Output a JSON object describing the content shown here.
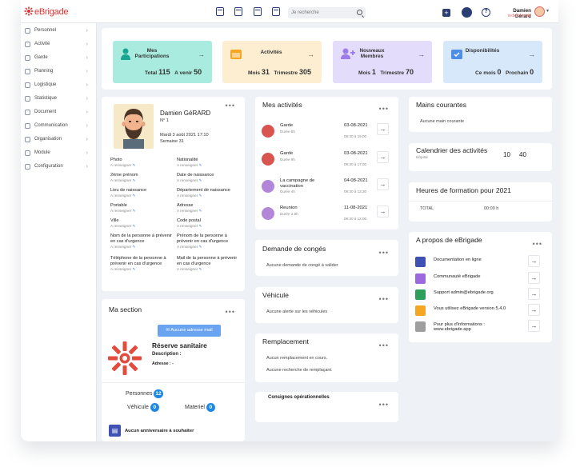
{
  "brand": {
    "name": "eBrigade",
    "color": "#d33"
  },
  "topbar": {
    "search_placeholder": "Je recherche",
    "user_name": "Damien Gérard",
    "user_status": "indisponible"
  },
  "sidebar": {
    "items": [
      {
        "label": "Personnel",
        "icon": "user-icon"
      },
      {
        "label": "Activité",
        "icon": "activity-icon"
      },
      {
        "label": "Garde",
        "icon": "shield-icon"
      },
      {
        "label": "Planning",
        "icon": "calendar-icon"
      },
      {
        "label": "Logistique",
        "icon": "truck-icon"
      },
      {
        "label": "Statistique",
        "icon": "chart-icon"
      },
      {
        "label": "Document",
        "icon": "document-icon"
      },
      {
        "label": "Communication",
        "icon": "mail-icon"
      },
      {
        "label": "Organisation",
        "icon": "org-icon"
      },
      {
        "label": "Module",
        "icon": "module-icon"
      },
      {
        "label": "Configuration",
        "icon": "gear-icon"
      }
    ]
  },
  "stats": [
    {
      "title": "Mes Participations",
      "v1_label": "Total",
      "v1": "115",
      "v2_label": "A venir",
      "v2": "50",
      "bg": "#a9ecdf",
      "color": "#1aa592"
    },
    {
      "title": "Activités",
      "v1_label": "Mois",
      "v1": "31",
      "v2_label": "Trimestre",
      "v2": "305",
      "bg": "#fdeed2",
      "color": "#f5a623"
    },
    {
      "title": "Nouveaux Membres",
      "v1_label": "Mois",
      "v1": "1",
      "v2_label": "Trimestre",
      "v2": "70",
      "bg": "#e4dcfb",
      "color": "#9a7be8"
    },
    {
      "title": "Disponibilités",
      "v1_label": "Ce mois",
      "v1": "0",
      "v2_label": "Prochain",
      "v2": "0",
      "bg": "#d8e8fb",
      "color": "#4f8ee6"
    }
  ],
  "profile": {
    "name": "Damien GéRARD",
    "number": "N° 1",
    "date": "Mardi 3 août 2021 17:10",
    "week": "Semaine 31",
    "todo": "A renseigner",
    "fields": [
      "Photo",
      "Nationalité",
      "2ème prénom",
      "Date de naissance",
      "Lieu de naissance",
      "Département de naissance",
      "Portable",
      "Adresse",
      "Ville",
      "Code postal",
      "Nom de la personne à prévenir en cas d'urgence",
      "Prénom de la personne à prévenir en cas d'urgence",
      "Téléphone de la personne à prévenir en cas d'urgence",
      "Mail de la personne à prévenir en cas d'urgence"
    ]
  },
  "section": {
    "title": "Ma section",
    "mail_button": "Aucune adresse mail",
    "name": "Réserve sanitaire",
    "description_label": "Description :",
    "address_label": "Adresse : -",
    "persons_label": "Personnes",
    "persons": "12",
    "vehicle_label": "Véhicule",
    "vehicle": "0",
    "material_label": "Materiel",
    "material": "0",
    "birthday": "Aucun anniversaire à souhaiter"
  },
  "activities": {
    "title": "Mes activités",
    "items": [
      {
        "name": "Garde",
        "duration": "Durée 5h",
        "date": "03-08-2021",
        "time": "09:30 à 15:00",
        "color": "#d9534f"
      },
      {
        "name": "Garde",
        "duration": "Durée 9h",
        "date": "03-08-2021",
        "time": "09:30 à 17:00",
        "color": "#d9534f"
      },
      {
        "name": "La campagne de vaccination",
        "duration": "Durée 4h",
        "date": "04-08-2021",
        "time": "09:30 à 13:30",
        "color": "#b287d9"
      },
      {
        "name": "Reunion",
        "duration": "Durée 2.5h",
        "date": "11-08-2021",
        "time": "09:30 à 12:00",
        "color": "#b287d9"
      }
    ]
  },
  "leave": {
    "title": "Demande de congés",
    "text": "Aucune demande de congé à valider"
  },
  "vehicle": {
    "title": "Véhicule",
    "text": "Aucune alerte sur les véhicules"
  },
  "replacement": {
    "title": "Remplacement",
    "line1": "Aucun remplacement en cours.",
    "line2": "Aucune recherche de remplaçant."
  },
  "consignes": {
    "title": "Consignes opérationnelles"
  },
  "main_courante": {
    "title": "Mains courantes",
    "text": "Aucune main courante"
  },
  "calendar": {
    "title": "Calendrier des activités",
    "sub": "Hôpital",
    "v1": "10",
    "v2": "40"
  },
  "training": {
    "title": "Heures de formation pour 2021",
    "label": "TOTAL",
    "value": "00:00 h"
  },
  "about": {
    "title": "A propos de eBrigade",
    "items": [
      {
        "text": "Documentation en ligne",
        "icon": "book-icon",
        "color": "#3f51b5"
      },
      {
        "text": "Communauté eBrigade",
        "icon": "link-icon",
        "color": "#9c6ade"
      },
      {
        "text": "Support admin@ebrigade.org",
        "icon": "mail-icon",
        "color": "#2e9e5b"
      },
      {
        "text": "Vous utilisez eBrigade version 5.4.0",
        "icon": "info-icon",
        "color": "#f5a623"
      },
      {
        "text": "Pour plus d'informations : www.ebrigade.app",
        "icon": "globe-icon",
        "color": "#9e9e9e"
      }
    ]
  }
}
